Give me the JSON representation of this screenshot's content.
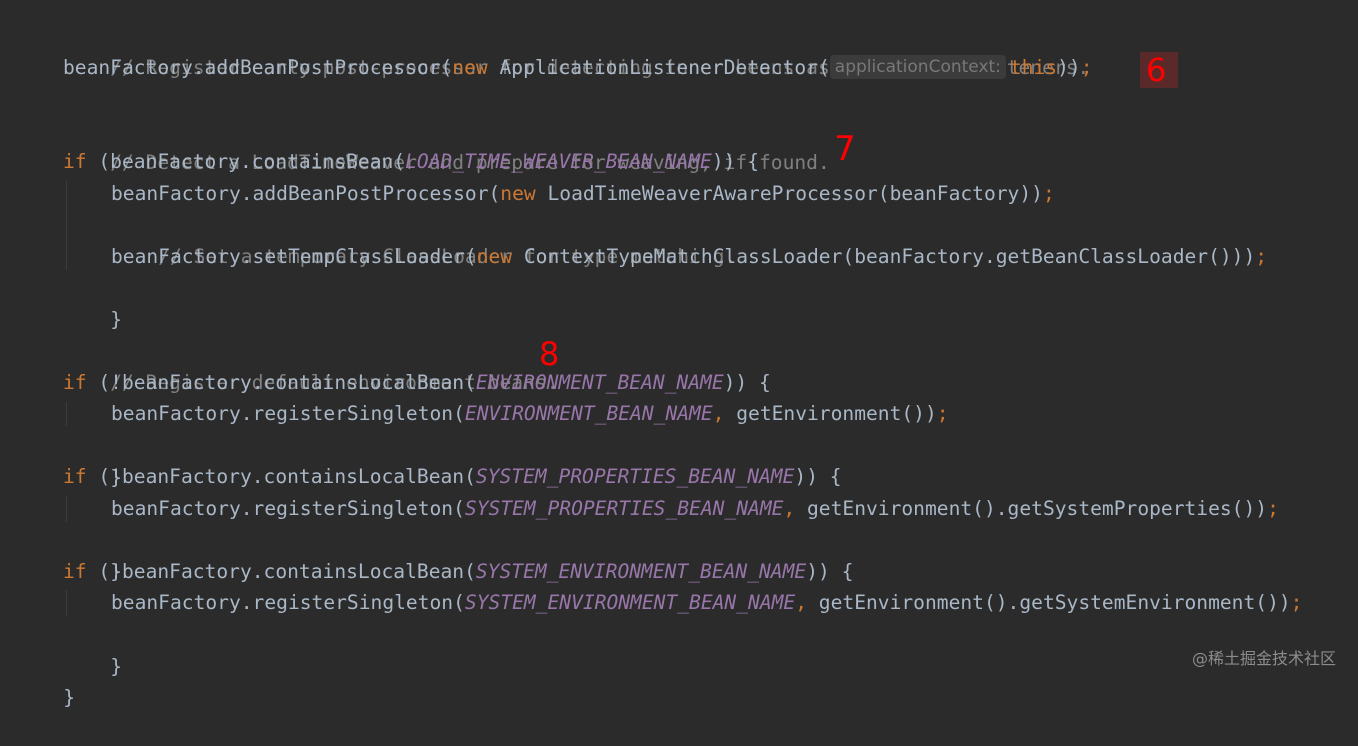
{
  "editor": {
    "lines": {
      "l1": {
        "comment": "// Register early post-processor for detecting inner beans as ApplicationListeners."
      },
      "l2": {
        "a": "beanFactory.addBeanPostProcessor(",
        "kw": "new",
        "b": " ApplicationListenerDetector(",
        "hint": "applicationContext:",
        "this": "this",
        "c": "))",
        "semi": ";"
      },
      "l4": {
        "comment": "// Detect a LoadTimeWeaver and prepare for weaving, if found."
      },
      "l5": {
        "kw": "if",
        "a": " (beanFactory.containsBean(",
        "const": "LOAD_TIME_WEAVER_BEAN_NAME",
        "b": ")) {"
      },
      "l6": {
        "a": "beanFactory.addBeanPostProcessor(",
        "kw": "new",
        "b": " LoadTimeWeaverAwareProcessor(beanFactory))",
        "semi": ";"
      },
      "l7": {
        "comment": "// Set a temporary ClassLoader for type matching."
      },
      "l8": {
        "a": "beanFactory.setTempClassLoader(",
        "kw": "new",
        "b": " ContextTypeMatchClassLoader(beanFactory.getBeanClassLoader()))",
        "semi": ";"
      },
      "l9": {
        "a": "}"
      },
      "l11": {
        "comment": "// Register default environment beans."
      },
      "l12": {
        "kw": "if",
        "a": " (!beanFactory.containsLocalBean(",
        "const": "ENVIRONMENT_BEAN_NAME",
        "b": ")) {"
      },
      "l13": {
        "a": "beanFactory.registerSingleton(",
        "const": "ENVIRONMENT_BEAN_NAME",
        "comma": ",",
        "b": " getEnvironment())",
        "semi": ";"
      },
      "l14": {
        "a": "}"
      },
      "l15": {
        "kw": "if",
        "a": " (!beanFactory.containsLocalBean(",
        "const": "SYSTEM_PROPERTIES_BEAN_NAME",
        "b": ")) {"
      },
      "l16": {
        "a": "beanFactory.registerSingleton(",
        "const": "SYSTEM_PROPERTIES_BEAN_NAME",
        "comma": ",",
        "b": " getEnvironment().getSystemProperties())",
        "semi": ";"
      },
      "l17": {
        "a": "}"
      },
      "l18": {
        "kw": "if",
        "a": " (!beanFactory.containsLocalBean(",
        "const": "SYSTEM_ENVIRONMENT_BEAN_NAME",
        "b": ")) {"
      },
      "l19": {
        "a": "beanFactory.registerSingleton(",
        "const": "SYSTEM_ENVIRONMENT_BEAN_NAME",
        "comma": ",",
        "b": " getEnvironment().getSystemEnvironment())",
        "semi": ";"
      },
      "l20": {
        "a": "}"
      },
      "l21": {
        "a": "}"
      }
    }
  },
  "annotations": {
    "six": "6",
    "seven": "7",
    "eight": "8"
  },
  "watermark": "@稀土掘金技术社区",
  "colors": {
    "background": "#2b2b2b",
    "keyword": "#cc7832",
    "comment": "#808080",
    "constant": "#9876aa",
    "text": "#a9b7c6",
    "annotation": "#ff0000"
  }
}
